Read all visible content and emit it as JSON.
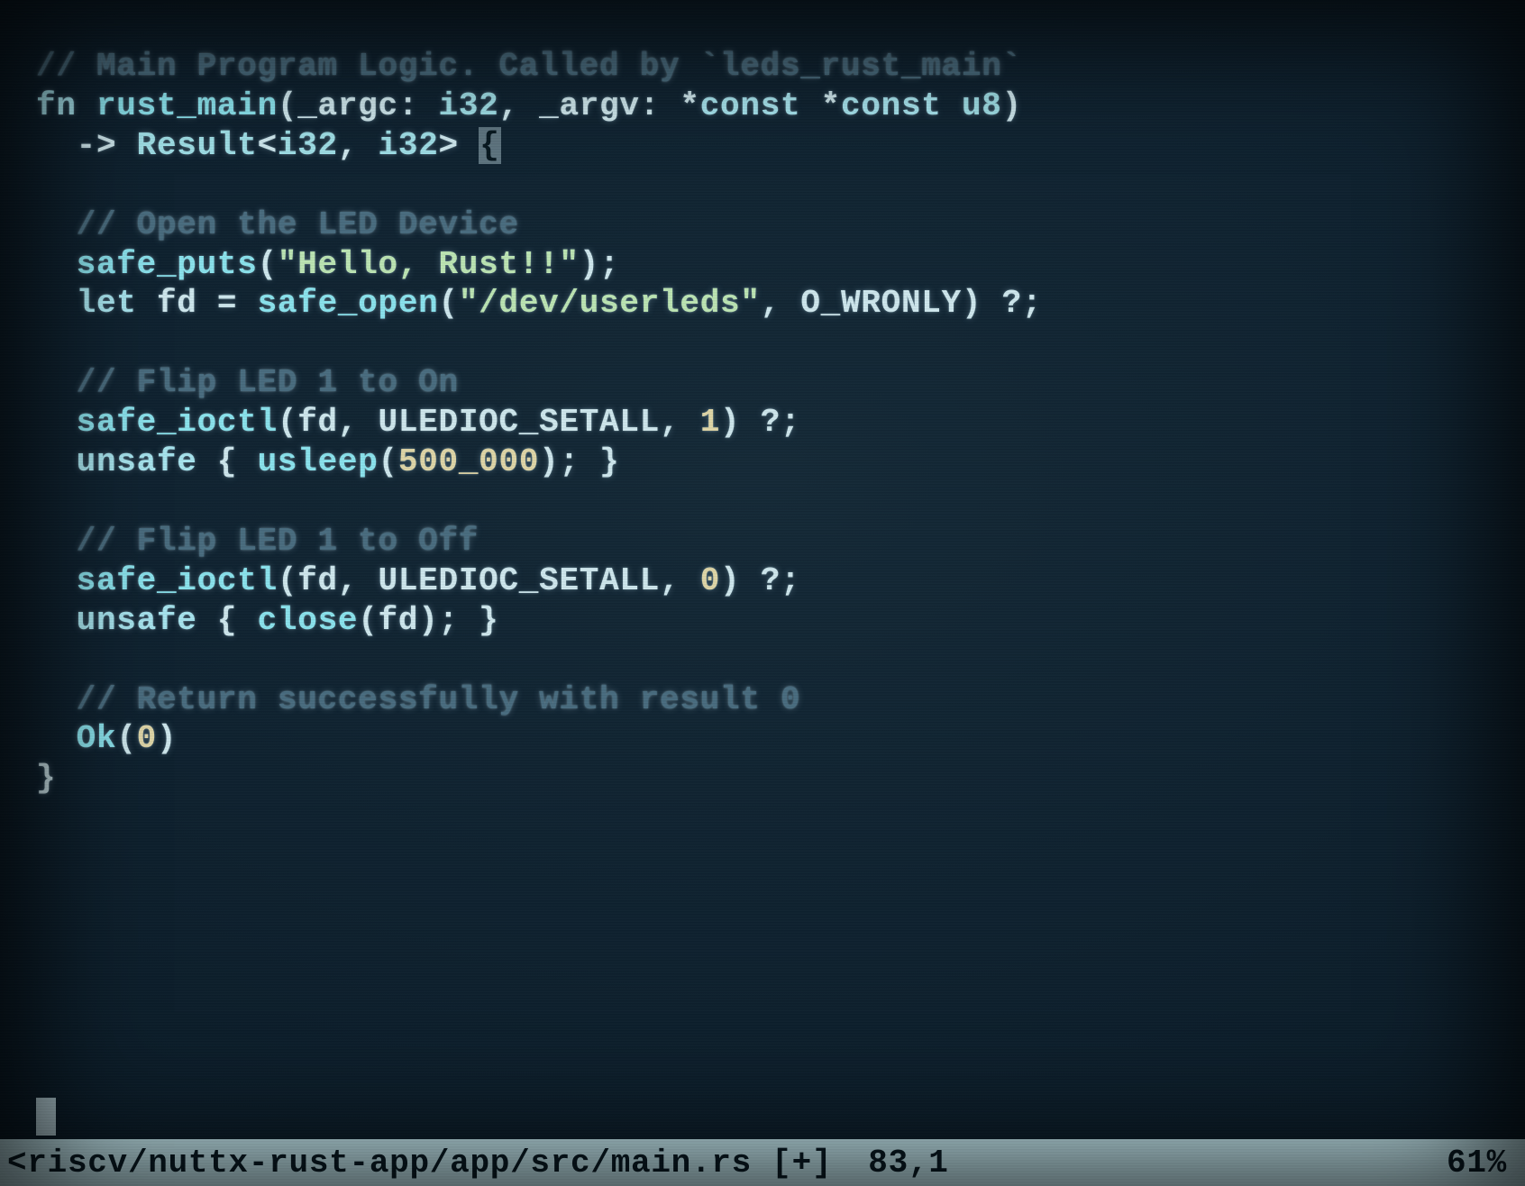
{
  "code": {
    "c0": "// Main Program Logic. Called by `leds_rust_main`",
    "l1_fn": "fn",
    "l1_name": " rust_main",
    "l1_args": "(_argc: ",
    "l1_i32a": "i32",
    "l1_mid": ", _argv: *",
    "l1_const1": "const",
    "l1_sp": " *",
    "l1_const2": "const",
    "l1_u8": " u8",
    "l1_close": ")",
    "l2_arrow": "  -> ",
    "l2_result": "Result",
    "l2_open": "<",
    "l2_i32a": "i32",
    "l2_comma": ", ",
    "l2_i32b": "i32",
    "l2_close": "> ",
    "l2_brace": "{",
    "c1": "  // Open the LED Device",
    "l3_pre": "  ",
    "l3_fn": "safe_puts",
    "l3_open": "(",
    "l3_str": "\"Hello, Rust!!\"",
    "l3_close": ");",
    "l4_pre": "  ",
    "l4_let": "let",
    "l4_fd": " fd = ",
    "l4_fn": "safe_open",
    "l4_open": "(",
    "l4_str": "\"/dev/userleds\"",
    "l4_comma": ", ",
    "l4_const": "O_WRONLY",
    "l4_close": ") ?;",
    "c2": "  // Flip LED 1 to On",
    "l5_pre": "  ",
    "l5_fn": "safe_ioctl",
    "l5_open": "(fd, ",
    "l5_const": "ULEDIOC_SETALL",
    "l5_mid": ", ",
    "l5_num": "1",
    "l5_close": ") ?;",
    "l6_pre": "  ",
    "l6_unsafe": "unsafe",
    "l6_open": " { ",
    "l6_fn": "usleep",
    "l6_paren": "(",
    "l6_num": "500_000",
    "l6_close": "); }",
    "c3": "  // Flip LED 1 to Off",
    "l7_pre": "  ",
    "l7_fn": "safe_ioctl",
    "l7_open": "(fd, ",
    "l7_const": "ULEDIOC_SETALL",
    "l7_mid": ", ",
    "l7_num": "0",
    "l7_close": ") ?;",
    "l8_pre": "  ",
    "l8_unsafe": "unsafe",
    "l8_open": " { ",
    "l8_fn": "close",
    "l8_close": "(fd); }",
    "c4": "  // Return successfully with result 0",
    "l9_pre": "  ",
    "l9_ok": "Ok",
    "l9_open": "(",
    "l9_num": "0",
    "l9_close": ")",
    "l10": "}"
  },
  "status": {
    "path": "<riscv/nuttx-rust-app/app/src/main.rs [+]",
    "pos": "83,1",
    "pct": "61%"
  },
  "colors": {
    "bg": "#0f2230",
    "statusbg": "#c9eef5",
    "statusfg": "#091b25"
  }
}
